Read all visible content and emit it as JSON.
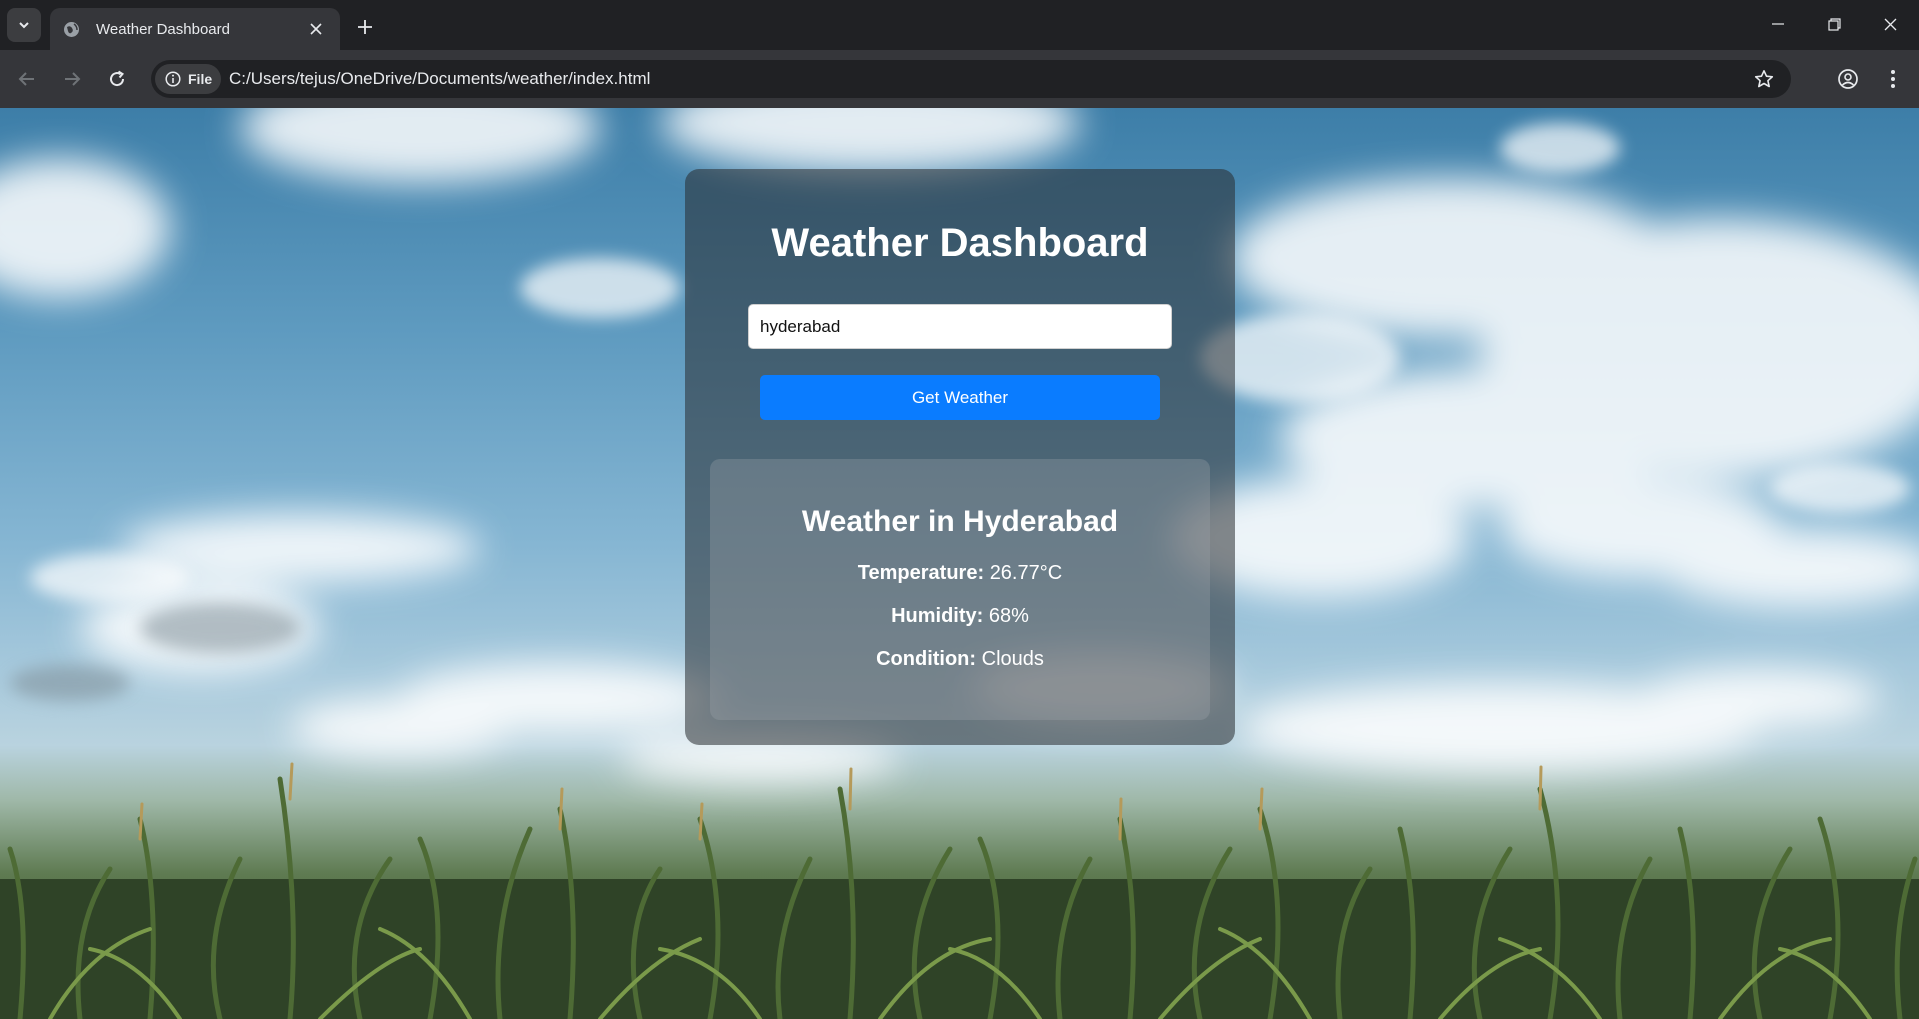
{
  "browser": {
    "tab_title": "Weather Dashboard",
    "site_chip": "File",
    "url": "C:/Users/tejus/OneDrive/Documents/weather/index.html",
    "icons": [
      "tab-search-icon",
      "globe-icon",
      "close-icon",
      "plus-icon",
      "minimize-icon",
      "restore-icon",
      "window-close-icon",
      "back-arrow-icon",
      "forward-arrow-icon",
      "reload-icon",
      "info-icon",
      "star-icon",
      "profile-icon",
      "kebab-menu-icon"
    ]
  },
  "page": {
    "title": "Weather Dashboard",
    "search": {
      "value": "hyderabad"
    },
    "button_label": "Get Weather",
    "result": {
      "heading": "Weather in Hyderabad",
      "temperature_label": "Temperature:",
      "temperature_value": "26.77°C",
      "humidity_label": "Humidity:",
      "humidity_value": "68%",
      "condition_label": "Condition:",
      "condition_value": "Clouds"
    }
  },
  "colors": {
    "button": "#0a7cff",
    "chrome_dark": "#202124",
    "chrome_tab": "#35363a"
  }
}
